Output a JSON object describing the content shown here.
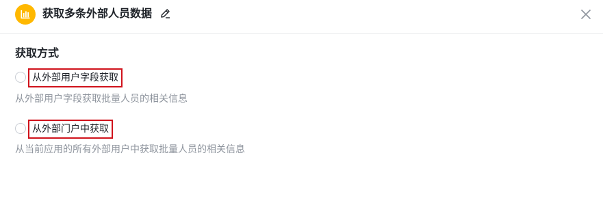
{
  "header": {
    "title": "获取多条外部人员数据"
  },
  "section": {
    "title": "获取方式"
  },
  "options": [
    {
      "label": "从外部用户字段获取",
      "description": "从外部用户字段获取批量人员的相关信息"
    },
    {
      "label": "从外部门户中获取",
      "description": "从当前应用的所有外部用户中获取批量人员的相关信息"
    }
  ],
  "colors": {
    "app_icon": "#ffb800",
    "highlight_border": "#d0121b"
  },
  "icons": {
    "app": "bar-chart-icon",
    "edit": "pencil-icon",
    "close": "close-icon"
  }
}
